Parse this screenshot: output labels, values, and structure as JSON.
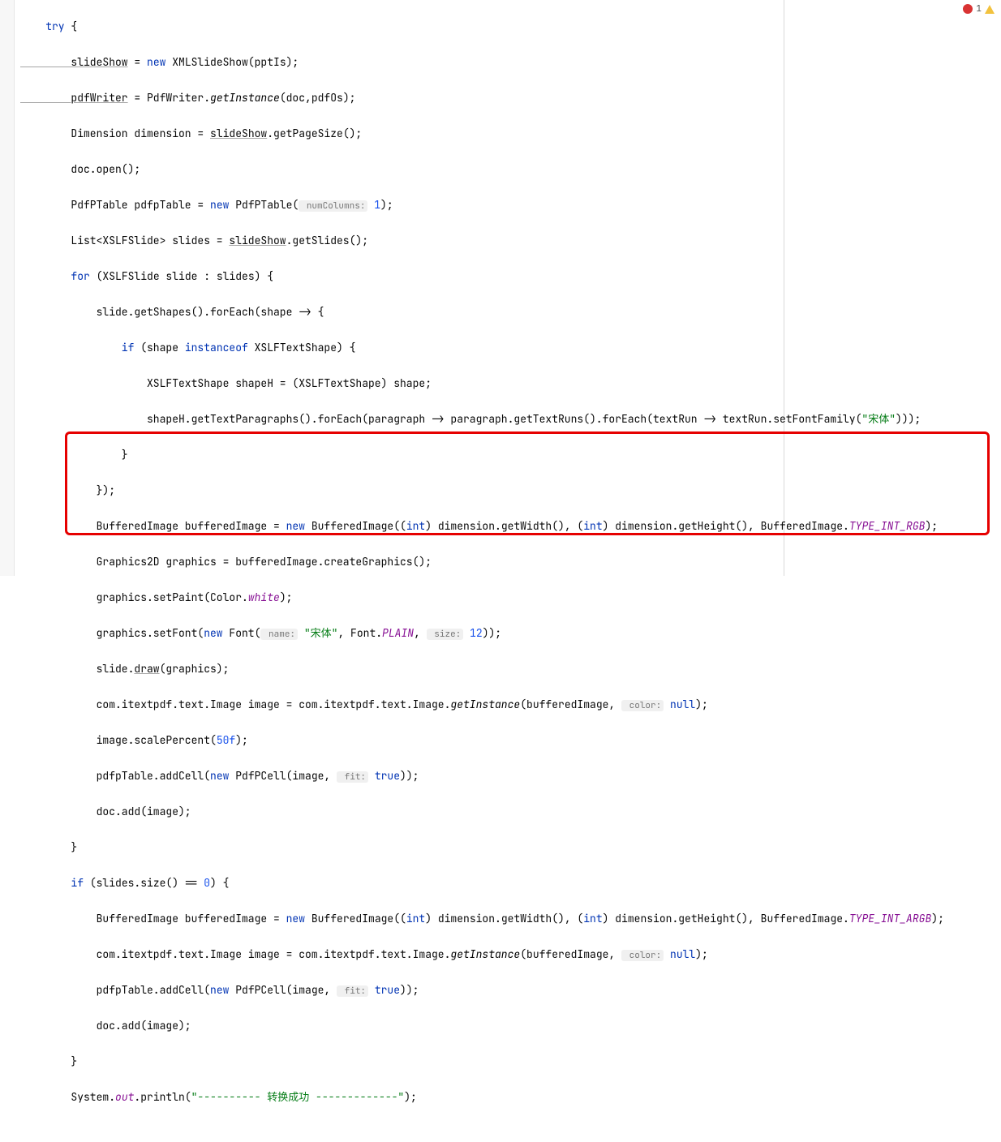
{
  "status": {
    "errors": "1",
    "warnings": ""
  },
  "code": {
    "l0": "    try {",
    "l1a": "        slideShow",
    "l1b": " = ",
    "l1c": "new",
    "l1d": " XMLSlideShow(pptIs);",
    "l2a": "        pdfWriter",
    "l2b": " = PdfWriter.",
    "l2c": "getInstance",
    "l2d": "(doc,pdfOs);",
    "l3a": "        Dimension dimension = ",
    "l3b": "slideShow",
    "l3c": ".getPageSize();",
    "l4": "        doc.open();",
    "l5a": "        PdfPTable pdfpTable = ",
    "l5b": "new",
    "l5c": " PdfPTable(",
    "l5h": " numColumns:",
    "l5d": " 1",
    "l5e": ");",
    "l6a": "        List<XSLFSlide> slides = ",
    "l6b": "slideShow",
    "l6c": ".getSlides();",
    "l7a": "        for",
    "l7b": " (XSLFSlide slide : slides) {",
    "l8": "            slide.getShapes().forEach(shape -> {",
    "l9a": "                if",
    "l9b": " (shape ",
    "l9c": "instanceof",
    "l9d": " XSLFTextShape) {",
    "l10": "                    XSLFTextShape shapeH = (XSLFTextShape) shape;",
    "l11a": "                    shapeH.getTextParagraphs().forEach(paragraph -> paragraph.getTextRuns().forEach(textRun -> textRun.setFontFamily(",
    "l11b": "\"宋体\"",
    "l11c": ")));",
    "l12": "                }",
    "l13": "            });",
    "l14a": "            BufferedImage bufferedImage = ",
    "l14b": "new",
    "l14c": " BufferedImage((",
    "l14d": "int",
    "l14e": ") dimension.getWidth(), (",
    "l14f": "int",
    "l14g": ") dimension.getHeight(), BufferedImage.",
    "l14h": "TYPE_INT_RGB",
    "l14i": ");",
    "l15": "            Graphics2D graphics = bufferedImage.createGraphics();",
    "l16a": "            graphics.setPaint(Color.",
    "l16b": "white",
    "l16c": ");",
    "l17a": "            graphics.setFont(",
    "l17b": "new",
    "l17c": " Font(",
    "l17h1": " name:",
    "l17d": " \"宋体\"",
    "l17e": ", Font.",
    "l17f": "PLAIN",
    "l17g": ", ",
    "l17h2": " size:",
    "l17h": " 12",
    "l17i": "));",
    "l18a": "            slide.",
    "l18b": "draw",
    "l18c": "(graphics);",
    "l19a": "            com.itextpdf.text.Image image = com.itextpdf.text.Image.",
    "l19b": "getInstance",
    "l19c": "(bufferedImage, ",
    "l19h": " color:",
    "l19d": " null",
    "l19e": ");",
    "l20a": "            image.scalePercent(",
    "l20b": "50f",
    "l20c": ");",
    "l21a": "            pdfpTable.addCell(",
    "l21b": "new",
    "l21c": " PdfPCell(image, ",
    "l21h": " fit:",
    "l21d": " true",
    "l21e": "));",
    "l22": "            doc.add(image);",
    "l23": "        }",
    "l24a": "        if",
    "l24b": " (slides.size() == ",
    "l24c": "0",
    "l24d": ") {",
    "l25a": "            BufferedImage bufferedImage = ",
    "l25b": "new",
    "l25c": " BufferedImage((",
    "l25d": "int",
    "l25e": ") dimension.getWidth(), (",
    "l25f": "int",
    "l25g": ") dimension.getHeight(), BufferedImage.",
    "l25h": "TYPE_INT_ARGB",
    "l25i": ");",
    "l26a": "            com.itextpdf.text.Image image = com.itextpdf.text.Image.",
    "l26b": "getInstance",
    "l26c": "(bufferedImage, ",
    "l26h": " color:",
    "l26d": " null",
    "l26e": ");",
    "l27a": "            pdfpTable.addCell(",
    "l27b": "new",
    "l27c": " PdfPCell(image, ",
    "l27h": " fit:",
    "l27d": " true",
    "l27e": "));",
    "l28": "            doc.add(image);",
    "l29": "        }",
    "l30a": "        System.",
    "l30b": "out",
    "l30c": ".println(",
    "l30d": "\"---------- 转换成功 -------------\"",
    "l30e": ");"
  }
}
